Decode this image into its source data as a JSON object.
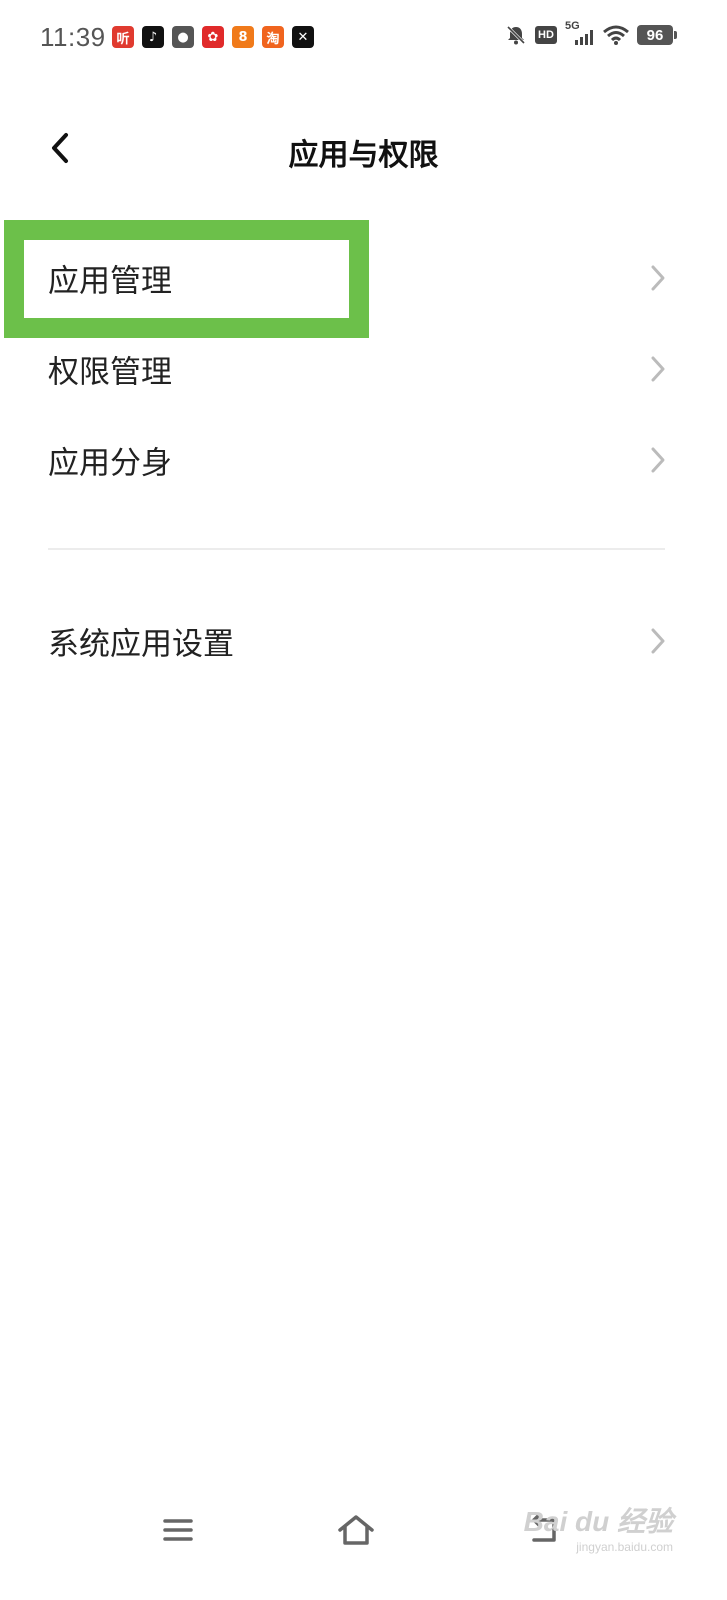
{
  "status_bar": {
    "time": "11:39",
    "notifications": [
      {
        "icon": "listen-app-icon",
        "glyph": "听",
        "color": "#e03a2f"
      },
      {
        "icon": "douyin-icon",
        "glyph": "♪",
        "color": "#111111"
      },
      {
        "icon": "wechat-icon",
        "glyph": "●",
        "color": "#555555"
      },
      {
        "icon": "huawei-flower-icon",
        "glyph": "✿",
        "color": "#e02a2a"
      },
      {
        "icon": "kuaishou-icon",
        "glyph": "8",
        "color": "#f07a1a"
      },
      {
        "icon": "taobao-icon",
        "glyph": "淘",
        "color": "#f0641e"
      },
      {
        "icon": "capcut-icon",
        "glyph": "✕",
        "color": "#111111"
      }
    ],
    "network": "5G",
    "hd": "HD",
    "battery": "96"
  },
  "header": {
    "title": "应用与权限"
  },
  "menu": {
    "app_management": "应用管理",
    "permission_management": "权限管理",
    "app_clone": "应用分身",
    "system_app_settings": "系统应用设置"
  },
  "watermark": {
    "brand": "Bai du 经验",
    "url": "jingyan.baidu.com"
  },
  "colors": {
    "highlight": "#6cc04a",
    "chevron": "#bbbbbb"
  }
}
